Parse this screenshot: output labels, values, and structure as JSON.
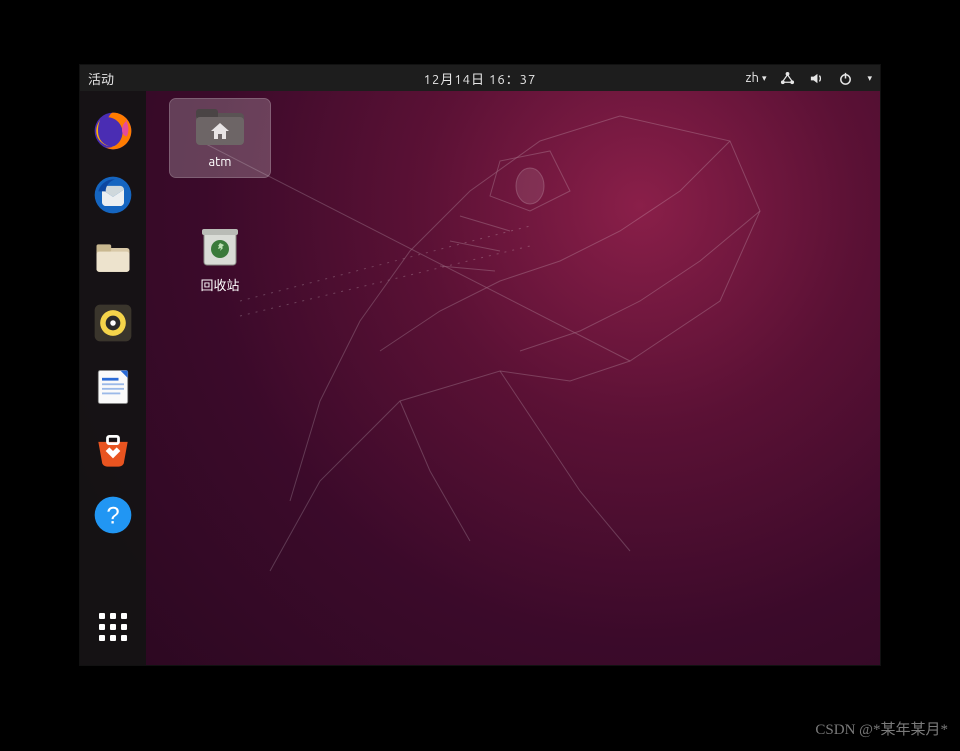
{
  "topbar": {
    "activities": "活动",
    "datetime": "12月14日 16：37",
    "lang": "zh"
  },
  "dock": {
    "items": [
      {
        "name": "firefox"
      },
      {
        "name": "thunderbird"
      },
      {
        "name": "files"
      },
      {
        "name": "rhythmbox"
      },
      {
        "name": "libreoffice-writer"
      },
      {
        "name": "ubuntu-software"
      },
      {
        "name": "help"
      }
    ]
  },
  "desktop": {
    "icons": [
      {
        "label": "atm",
        "type": "folder",
        "selected": true
      },
      {
        "label": "回收站",
        "type": "trash",
        "selected": false
      }
    ]
  },
  "watermark": "CSDN @*某年某月*"
}
